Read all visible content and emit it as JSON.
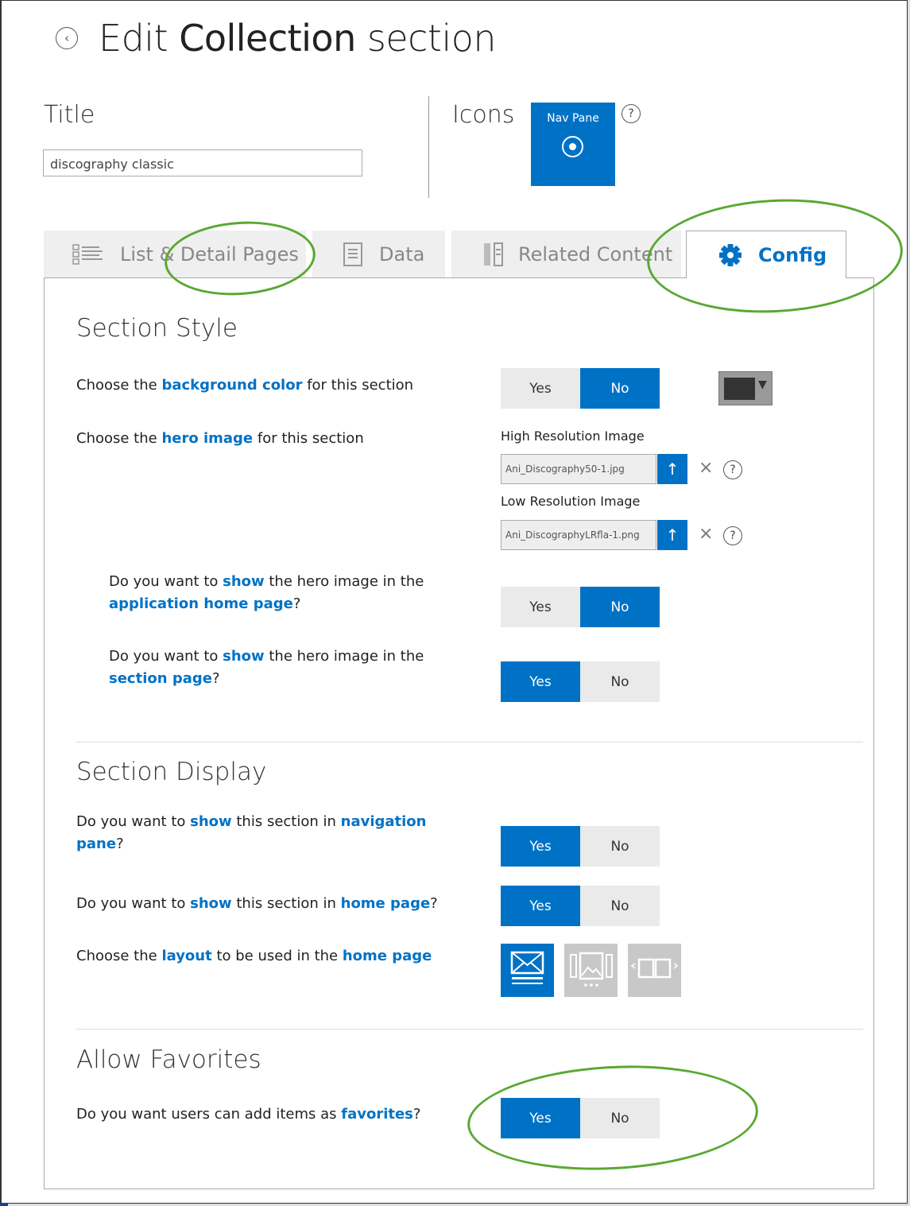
{
  "header": {
    "title_pre": "Edit ",
    "title_bold": "Collection",
    "title_post": " section"
  },
  "title_field": {
    "label": "Title",
    "value": "discography classic"
  },
  "icons": {
    "label": "Icons",
    "nav_pane_label": "Nav Pane",
    "help": "?"
  },
  "tabs": [
    {
      "label": "List & Detail Pages",
      "icon": "list-icon"
    },
    {
      "label": "Data",
      "icon": "document-icon"
    },
    {
      "label": "Related Content",
      "icon": "related-icon"
    },
    {
      "label": "Config",
      "icon": "gear-icon",
      "active": true
    }
  ],
  "section_style": {
    "heading": "Section Style",
    "bg_color": {
      "q_pre": "Choose the ",
      "q_hl": "background color",
      "q_post": " for this section",
      "yes": "Yes",
      "no": "No",
      "selected": "No",
      "swatch_color": "#333333"
    },
    "hero": {
      "q_pre": "Choose the ",
      "q_hl": "hero image",
      "q_post": " for this section",
      "high_label": "High Resolution Image",
      "high_file": "Ani_Discography50-1.jpg",
      "low_label": "Low Resolution Image",
      "low_file": "Ani_DiscographyLRfla-1.png"
    },
    "show_home": {
      "q1_pre": "Do you want to ",
      "q1_hl": "show",
      "q1_post": " the hero image in the",
      "q2_hl": "application home page",
      "q2_post": "?",
      "yes": "Yes",
      "no": "No",
      "selected": "No"
    },
    "show_section": {
      "q1_pre": "Do you want to ",
      "q1_hl": "show",
      "q1_post": " the hero image in the",
      "q2_hl": "section page",
      "q2_post": "?",
      "yes": "Yes",
      "no": "No",
      "selected": "Yes"
    }
  },
  "section_display": {
    "heading": "Section Display",
    "nav": {
      "q1_pre": "Do you want to ",
      "q1_hl": "show",
      "q1_mid": " this section in ",
      "q1_hl2": "navigation",
      "q2_hl": "pane",
      "q2_post": "?",
      "yes": "Yes",
      "no": "No",
      "selected": "Yes"
    },
    "home": {
      "q_pre": "Do you want to ",
      "q_hl": "show",
      "q_mid": " this section in ",
      "q_hl2": "home page",
      "q_post": "?",
      "yes": "Yes",
      "no": "No",
      "selected": "Yes"
    },
    "layout": {
      "q_pre": "Choose the ",
      "q_hl": "layout",
      "q_mid": " to be used in the ",
      "q_hl2": "home page",
      "selected_index": 0
    }
  },
  "favorites": {
    "heading": "Allow Favorites",
    "q_pre": "Do you want users can add items as ",
    "q_hl": "favorites",
    "q_post": "?",
    "yes": "Yes",
    "no": "No",
    "selected": "Yes"
  },
  "colors": {
    "accent": "#0072c6",
    "annotation": "#5aa832"
  }
}
